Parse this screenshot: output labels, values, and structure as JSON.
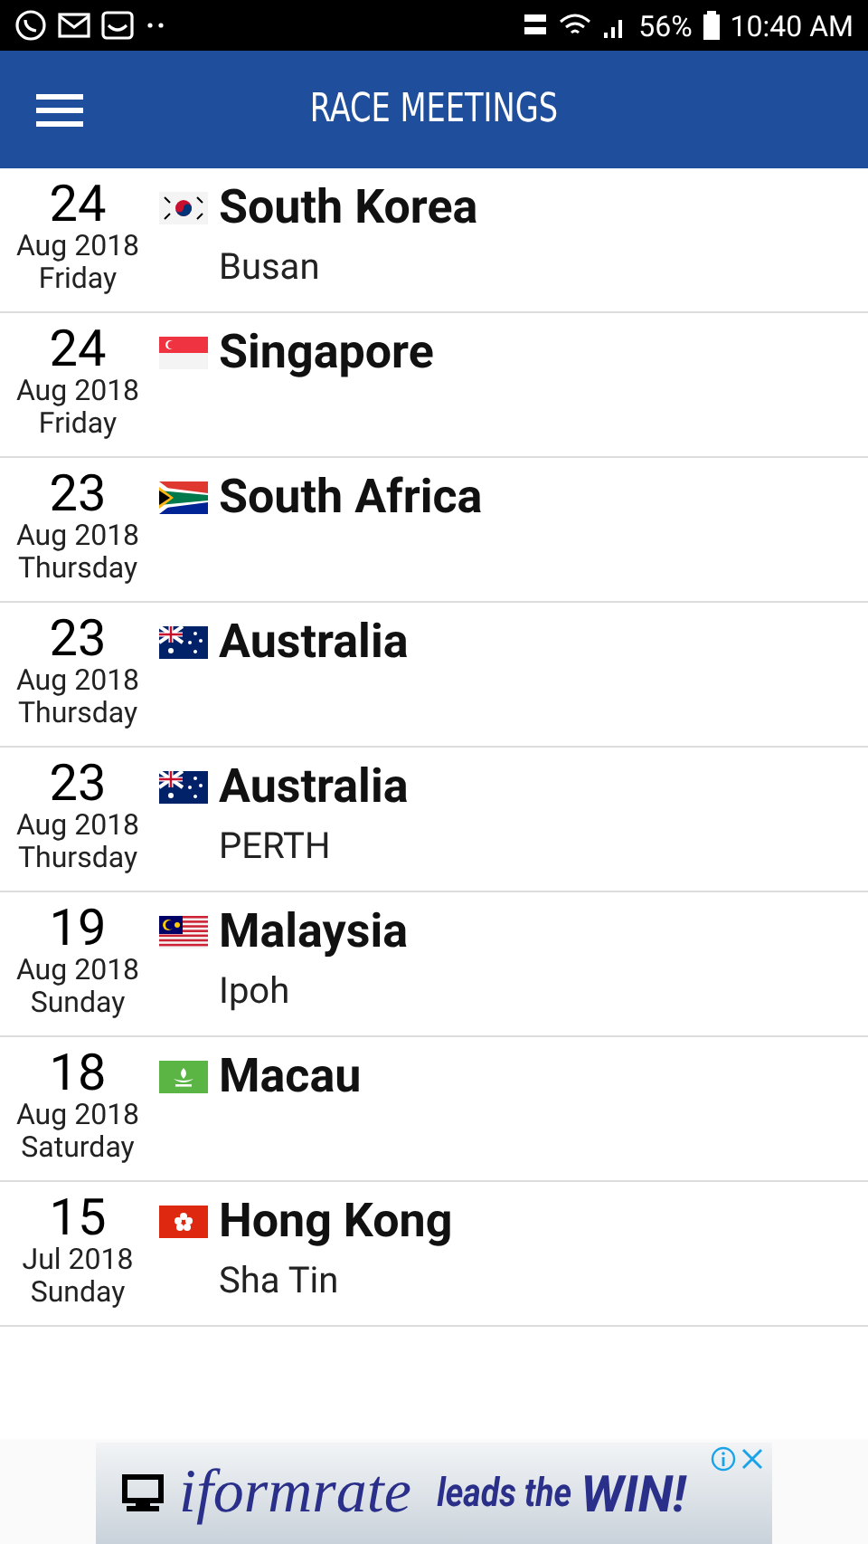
{
  "status_bar": {
    "battery": "56%",
    "time": "10:40 AM"
  },
  "app_bar": {
    "title": "RACE MEETINGS"
  },
  "meetings": [
    {
      "day": "24",
      "month_year": "Aug 2018",
      "weekday": "Friday",
      "kind": "kr",
      "country": "South Korea",
      "venue": "Busan"
    },
    {
      "day": "24",
      "month_year": "Aug 2018",
      "weekday": "Friday",
      "kind": "sg",
      "country": "Singapore"
    },
    {
      "day": "23",
      "month_year": "Aug 2018",
      "weekday": "Thursday",
      "kind": "za",
      "country": "South Africa"
    },
    {
      "day": "23",
      "month_year": "Aug 2018",
      "weekday": "Thursday",
      "kind": "au",
      "country": "Australia"
    },
    {
      "day": "23",
      "month_year": "Aug 2018",
      "weekday": "Thursday",
      "kind": "au",
      "country": "Australia",
      "venue": "PERTH"
    },
    {
      "day": "19",
      "month_year": "Aug 2018",
      "weekday": "Sunday",
      "kind": "my",
      "country": "Malaysia",
      "venue": "Ipoh"
    },
    {
      "day": "18",
      "month_year": "Aug 2018",
      "weekday": "Saturday",
      "kind": "mo",
      "country": "Macau"
    },
    {
      "day": "15",
      "month_year": "Jul 2018",
      "weekday": "Sunday",
      "kind": "hk",
      "country": "Hong Kong",
      "venue": "Sha Tin"
    }
  ],
  "ad": {
    "brand": "iformrate",
    "slogan": "leads the",
    "tagline": "WIN!"
  }
}
